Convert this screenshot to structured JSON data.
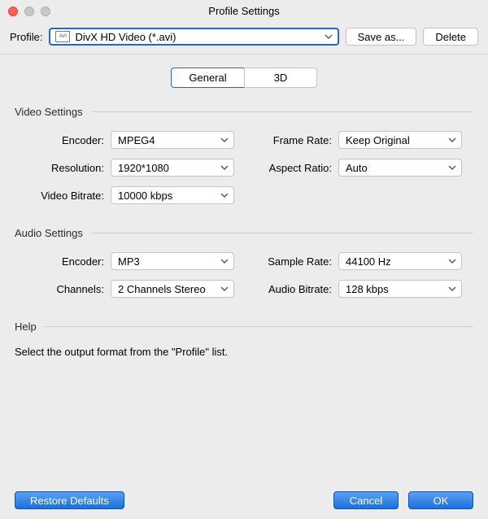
{
  "window": {
    "title": "Profile Settings"
  },
  "topbar": {
    "profile_label": "Profile:",
    "profile_value": "DivX HD Video (*.avi)",
    "save_as_label": "Save as...",
    "delete_label": "Delete"
  },
  "tabs": {
    "general": "General",
    "three_d": "3D"
  },
  "video": {
    "section_title": "Video Settings",
    "encoder_label": "Encoder:",
    "encoder_value": "MPEG4",
    "frame_rate_label": "Frame Rate:",
    "frame_rate_value": "Keep Original",
    "resolution_label": "Resolution:",
    "resolution_value": "1920*1080",
    "aspect_label": "Aspect Ratio:",
    "aspect_value": "Auto",
    "bitrate_label": "Video Bitrate:",
    "bitrate_value": "10000 kbps"
  },
  "audio": {
    "section_title": "Audio Settings",
    "encoder_label": "Encoder:",
    "encoder_value": "MP3",
    "sample_rate_label": "Sample Rate:",
    "sample_rate_value": "44100 Hz",
    "channels_label": "Channels:",
    "channels_value": "2 Channels Stereo",
    "bitrate_label": "Audio Bitrate:",
    "bitrate_value": "128 kbps"
  },
  "help": {
    "section_title": "Help",
    "text": "Select the output format from the \"Profile\" list."
  },
  "footer": {
    "restore_label": "Restore Defaults",
    "cancel_label": "Cancel",
    "ok_label": "OK"
  }
}
